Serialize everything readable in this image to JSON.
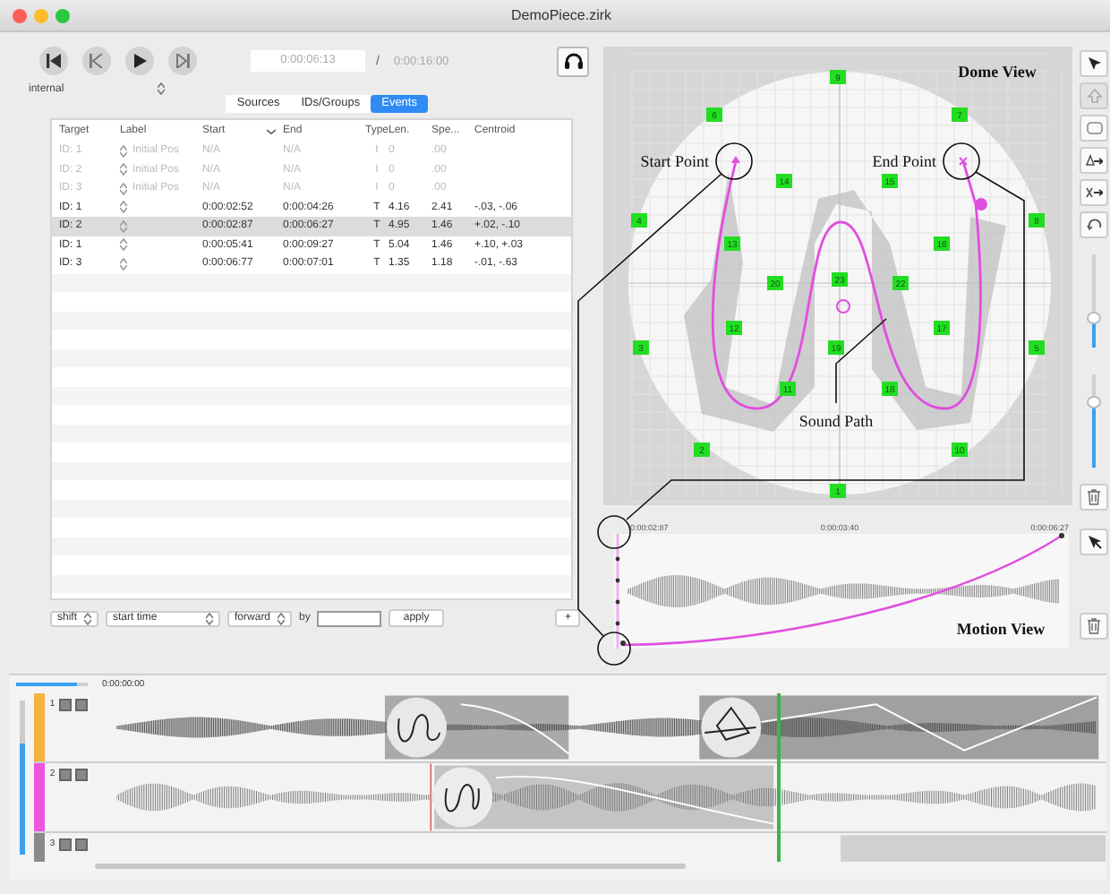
{
  "window": {
    "title": "DemoPiece.zirk"
  },
  "transport": {
    "clock_source": "internal",
    "current_time": "0:00:06:13",
    "separator": "/",
    "total_time": "0:00:16:00"
  },
  "tabs": [
    {
      "label": "Sources",
      "selected": false
    },
    {
      "label": "IDs/Groups",
      "selected": false
    },
    {
      "label": "Events",
      "selected": true
    }
  ],
  "events_table": {
    "columns": [
      "Target",
      "Label",
      "Start",
      "End",
      "Type",
      "Len.",
      "Spe...",
      "Centroid"
    ],
    "rows": [
      {
        "target": "ID: 1",
        "label": "Initial Pos",
        "start": "N/A",
        "end": "N/A",
        "type": "I",
        "length": "0",
        "speed": ".00",
        "disabled": true,
        "selected": false
      },
      {
        "target": "ID: 2",
        "label": "Initial Pos",
        "start": "N/A",
        "end": "N/A",
        "type": "I",
        "length": "0",
        "speed": ".00",
        "disabled": true,
        "selected": false
      },
      {
        "target": "ID: 3",
        "label": "Initial Pos",
        "start": "N/A",
        "end": "N/A",
        "type": "I",
        "length": "0",
        "speed": ".00",
        "disabled": true,
        "selected": false
      },
      {
        "target": "ID: 1",
        "start": "0:00:02:52",
        "end": "0:00:04:26",
        "type": "T",
        "length": "4.16",
        "speed": "2.41",
        "centroid": "-.03, -.06",
        "disabled": false,
        "selected": false
      },
      {
        "target": "ID: 2",
        "start": "0:00:02:87",
        "end": "0:00:06:27",
        "type": "T",
        "length": "4.95",
        "speed": "1.46",
        "centroid": "+.02, -.10",
        "disabled": false,
        "selected": true
      },
      {
        "target": "ID: 1",
        "start": "0:00:05:41",
        "end": "0:00:09:27",
        "type": "T",
        "length": "5.04",
        "speed": "1.46",
        "centroid": "+.10, +.03",
        "disabled": false,
        "selected": false
      },
      {
        "target": "ID: 3",
        "start": "0:00:06:77",
        "end": "0:00:07:01",
        "type": "T",
        "length": "1.35",
        "speed": "1.18",
        "centroid": "-.01, -.63",
        "disabled": false,
        "selected": false
      }
    ]
  },
  "shift_controls": {
    "mode": "shift",
    "field": "start time",
    "direction": "forward",
    "by_label": "by",
    "apply": "apply",
    "add": "+"
  },
  "dome_view": {
    "title": "Dome View",
    "speakers": [
      "9",
      "6",
      "7",
      "14",
      "15",
      "4",
      "8",
      "13",
      "16",
      "20",
      "23",
      "22",
      "12",
      "17",
      "3",
      "19",
      "5",
      "11",
      "18",
      "2",
      "10",
      "1"
    ]
  },
  "annotations": {
    "start_point": "Start Point",
    "end_point": "End Point",
    "sound_path": "Sound Path"
  },
  "motion_view": {
    "title": "Motion View",
    "time_labels": [
      "0:00:02:87",
      "0:00:03:40",
      "0:00:06:27"
    ]
  },
  "tool_sliders": [
    {
      "level": 0.3
    },
    {
      "level": 0.7
    }
  ],
  "timeline": {
    "zoom_slider": {
      "level": 0.85
    },
    "time": "0:00:00:00",
    "volume_slider": {
      "level": 0.72
    },
    "tracks": [
      {
        "number": "1",
        "color": "#f5b340"
      },
      {
        "number": "2",
        "color": "#ee55dd"
      },
      {
        "number": "3",
        "color": "#8a8a8a"
      }
    ]
  }
}
